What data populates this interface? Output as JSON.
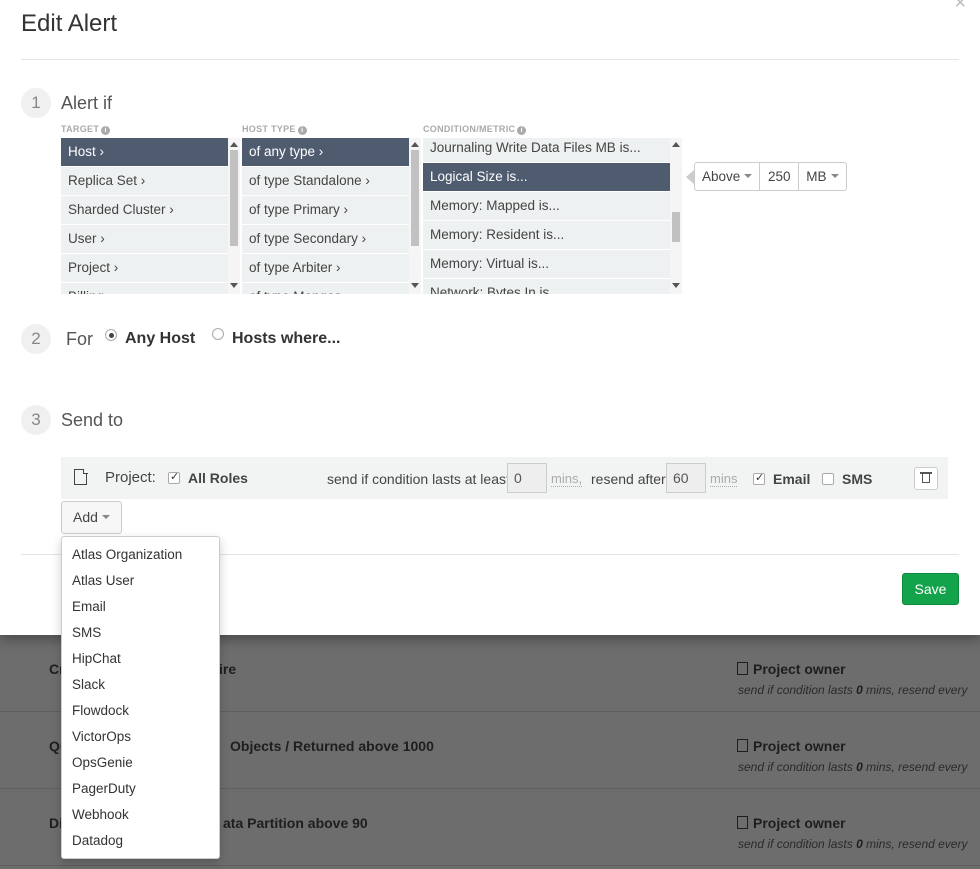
{
  "modal": {
    "title": "Edit Alert",
    "close": "×"
  },
  "step1": {
    "number": "1",
    "label": "Alert if",
    "target_header": "TARGET",
    "host_type_header": "HOST TYPE",
    "condition_header": "CONDITION/METRIC",
    "info_glyph": "i",
    "targets": [
      "Host ›",
      "Replica Set ›",
      "Sharded Cluster ›",
      "User ›",
      "Project ›",
      "Billing ›"
    ],
    "host_types": [
      "of any type ›",
      "of type Standalone ›",
      "of type Primary ›",
      "of type Secondary ›",
      "of type Arbiter ›",
      "of type Mongos ›"
    ],
    "conditions": [
      "Journaling Write Data Files MB is...",
      "Logical Size is...",
      "Memory: Mapped is...",
      "Memory: Resident is...",
      "Memory: Virtual is...",
      "Network: Bytes In is..."
    ],
    "operator": "Above",
    "threshold": "250",
    "unit": "MB"
  },
  "step2": {
    "number": "2",
    "label": "For",
    "option_any": "Any Host",
    "option_where": "Hosts where..."
  },
  "step3": {
    "number": "3",
    "label": "Send to",
    "recipient_label": "Project:",
    "roles_label": "All Roles",
    "send_if_text": "send if condition lasts at least",
    "send_if_value": "0",
    "mins_unit": "mins,",
    "resend_text": "resend after",
    "resend_value": "60",
    "mins_unit2": "mins",
    "email_label": "Email",
    "sms_label": "SMS",
    "add_label": "Add",
    "save_label": "Save"
  },
  "add_menu": [
    "Atlas Organization",
    "Atlas User",
    "Email",
    "SMS",
    "HipChat",
    "Slack",
    "Flowdock",
    "VictorOps",
    "OpsGenie",
    "PagerDuty",
    "Webhook",
    "Datadog"
  ],
  "background_rows": [
    {
      "left_text": "Cr",
      "right_text": "ire",
      "owner": "Project owner",
      "resend_prefix": "send if condition lasts ",
      "resend_value": "0",
      "resend_suffix": " mins, resend every"
    },
    {
      "left_text": "Qu",
      "right_text": "Objects / Returned above 1000",
      "owner": "Project owner",
      "resend_prefix": "send if condition lasts ",
      "resend_value": "0",
      "resend_suffix": " mins, resend every"
    },
    {
      "left_text": "Di",
      "right_text": "ata Partition above 90",
      "owner": "Project owner",
      "resend_prefix": "send if condition lasts ",
      "resend_value": "0",
      "resend_suffix": " mins, resend every"
    }
  ],
  "colors": {
    "selected_item": "#4f5b6f",
    "list_bg": "#eef1f1",
    "save_green": "#13a44b",
    "backdrop": "#6d6d6d"
  }
}
